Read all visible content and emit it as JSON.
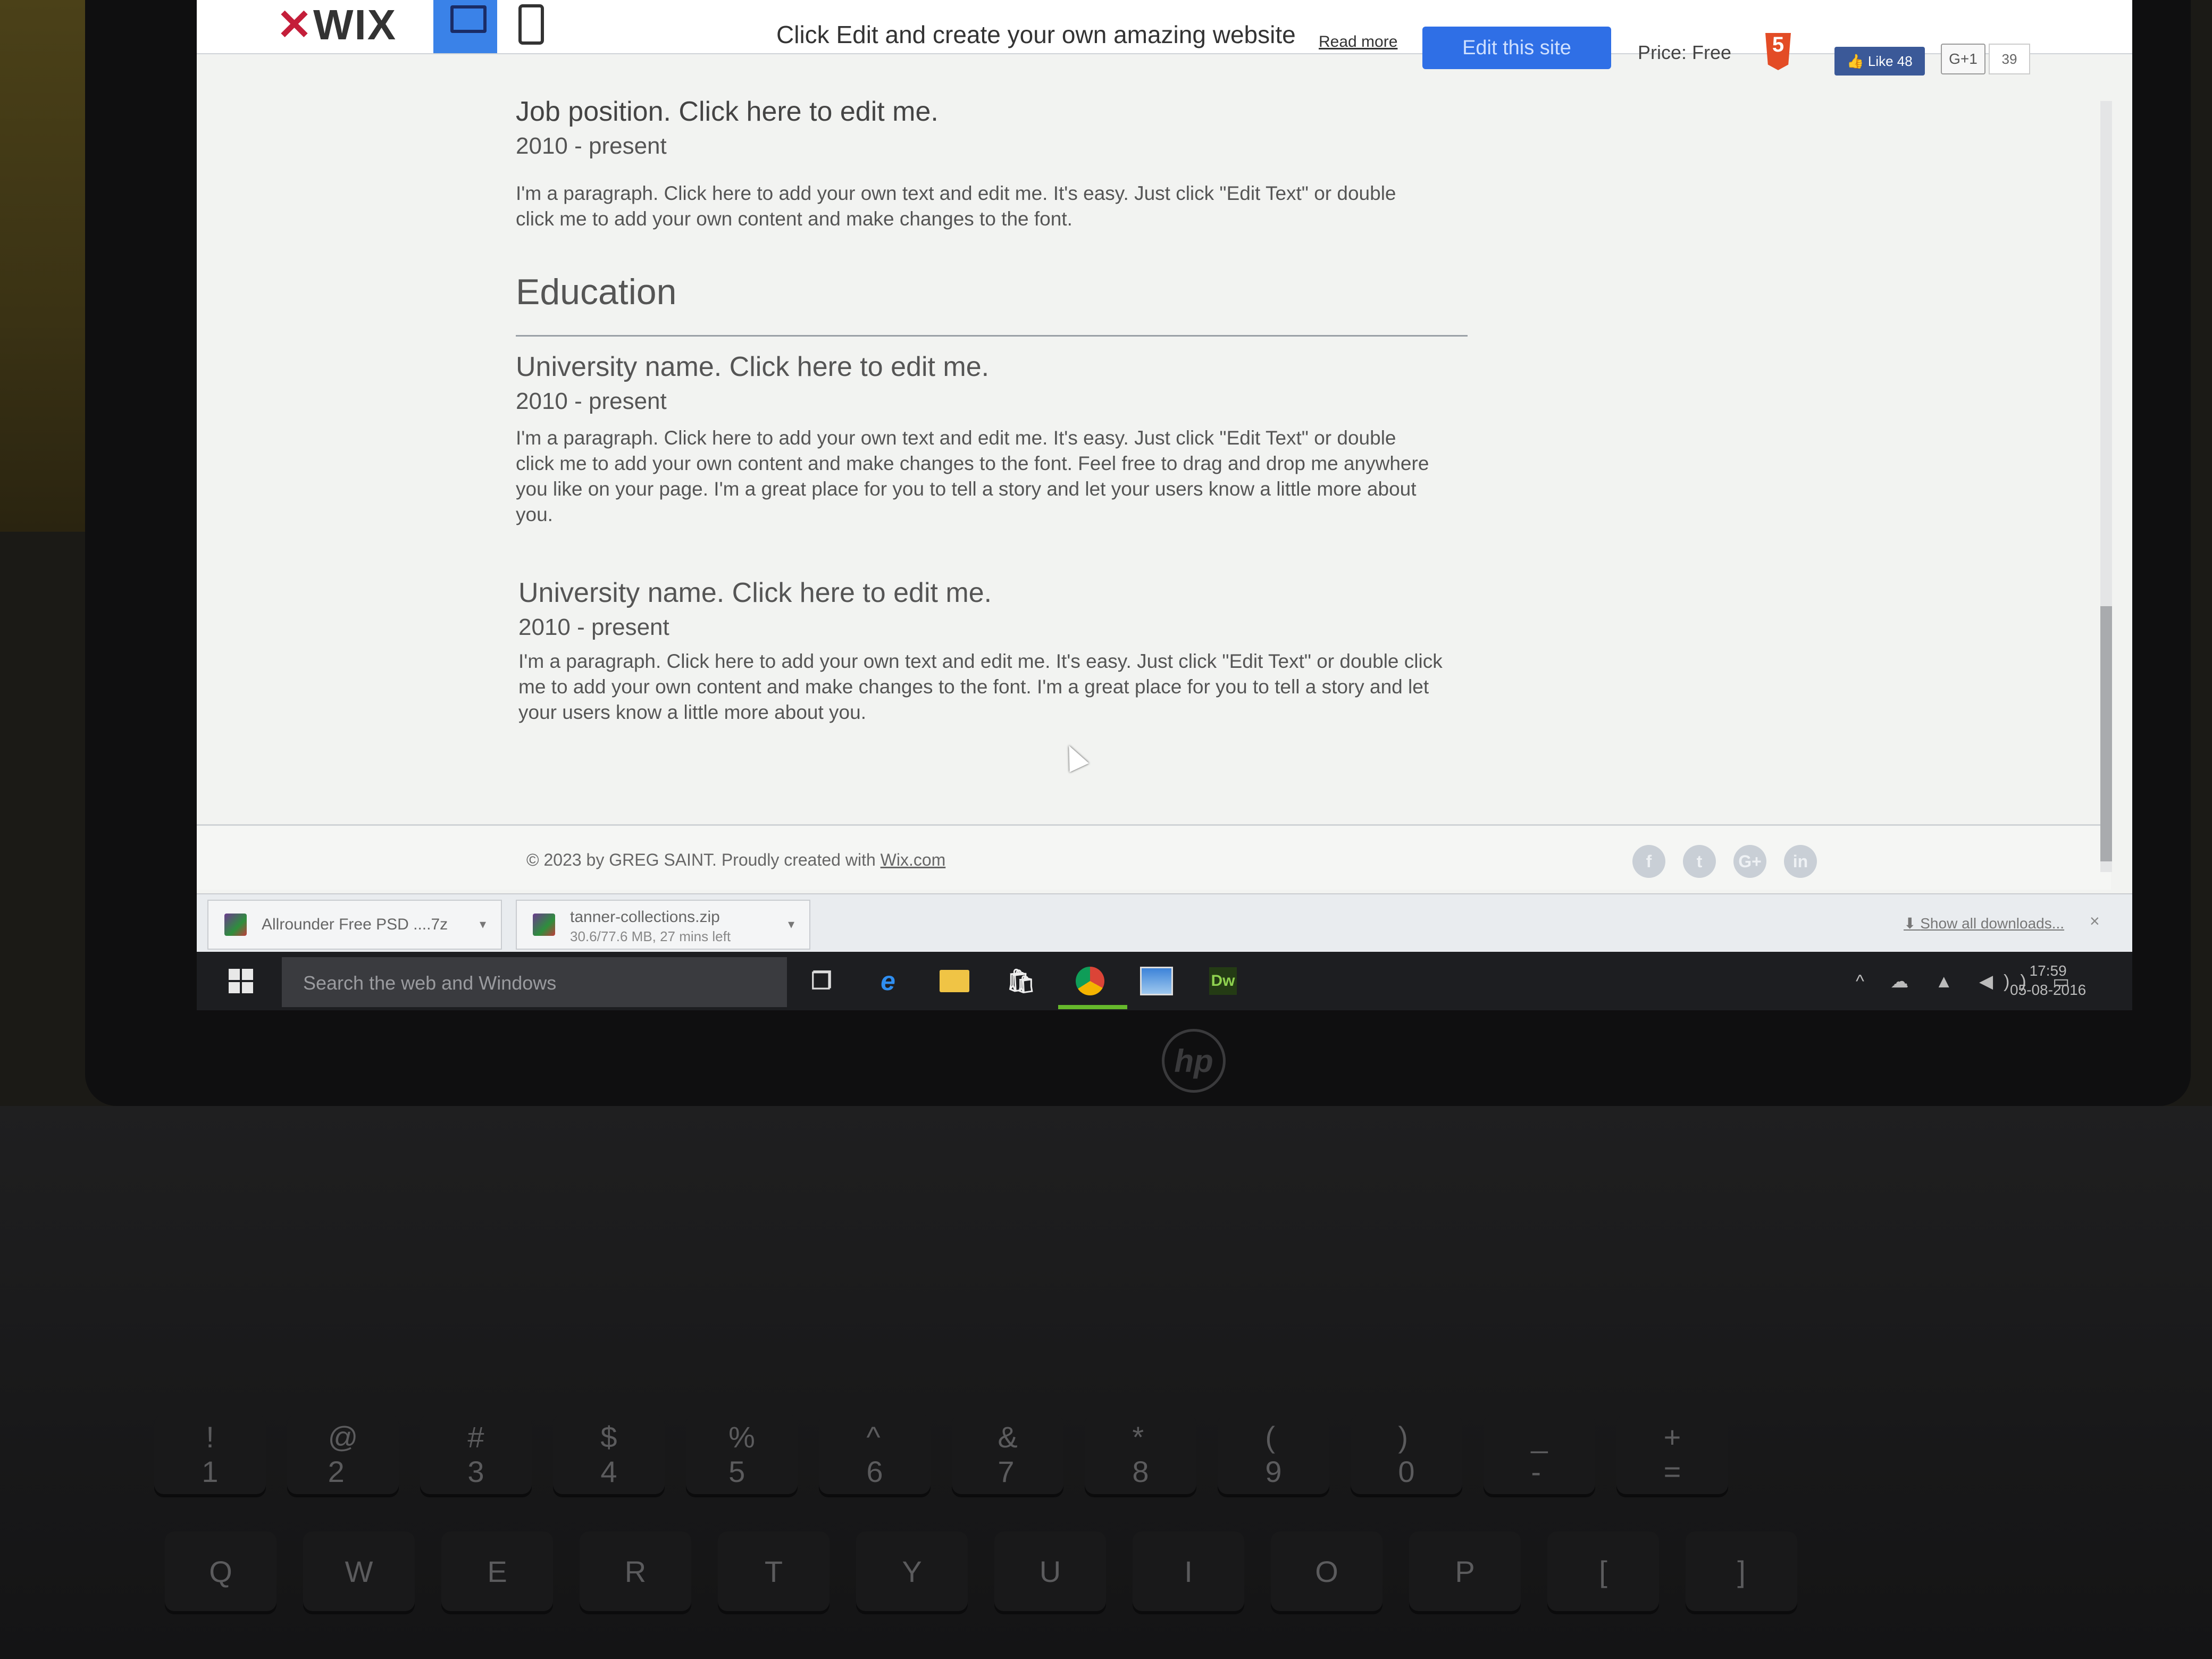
{
  "wixbar": {
    "logo": "WIX",
    "promo_text": "Click Edit and create your own amazing website",
    "read_more": "Read more",
    "edit_button": "Edit this site",
    "price": "Price: Free",
    "html5_icon": "html5-icon",
    "fb_like": "Like 48",
    "gplus_label": "G+1",
    "gplus_count": "39"
  },
  "resume": {
    "job": {
      "title": "Job position. Click here to edit me.",
      "date": "2010 - present",
      "paragraph": "I'm a paragraph. Click here to add your own text and edit me. It's easy. Just click \"Edit Text\" or double click me to add your own content and make changes to the font."
    },
    "education_title": "Education",
    "education": [
      {
        "title": "University name. Click here to edit me.",
        "date": "2010 - present",
        "paragraph": "I'm a paragraph. Click here to add your own text and edit me. It's easy. Just click \"Edit Text\" or double click me to add your own content and make changes to the font. Feel free to drag and drop me anywhere you like on your page. I'm a great place for you to tell a story and let your users know a little more about you."
      },
      {
        "title": "University name. Click here to edit me.",
        "date": "2010 - present",
        "paragraph": "I'm a paragraph. Click here to add your own text and edit me. It's easy. Just click \"Edit Text\" or double click me to add your own content and make changes to the font. I'm a great place for you to tell a story and let your users know a little more about you."
      }
    ]
  },
  "footer": {
    "copyright": "© 2023 by GREG SAINT. Proudly created with ",
    "link": "Wix.com",
    "social": [
      "f",
      "t",
      "G+",
      "in"
    ]
  },
  "downloads": {
    "items": [
      {
        "name": "Allrounder Free PSD ....7z",
        "sub": ""
      },
      {
        "name": "tanner-collections.zip",
        "sub": "30.6/77.6 MB, 27 mins left"
      }
    ],
    "show_all": "Show all downloads...",
    "close": "×"
  },
  "taskbar": {
    "search_placeholder": "Search the web and Windows",
    "apps": [
      "task-view-icon",
      "edge-icon",
      "file-explorer-icon",
      "store-icon",
      "chrome-icon",
      "photos-icon",
      "dreamweaver-icon"
    ],
    "dw_label": "Dw",
    "clock_time": "17:59",
    "clock_date": "05-08-2016"
  },
  "keyboard": {
    "hp_logo": "hp",
    "number_row": [
      "!\n1",
      "@\n2",
      "#\n3",
      "$\n4",
      "%\n5",
      "^\n6",
      "&\n7",
      "*\n8",
      "(\n9",
      ")\n0",
      "_\n-",
      "+\n="
    ],
    "letter_row": [
      "Q",
      "W",
      "E",
      "R",
      "T",
      "Y",
      "U",
      "I",
      "O",
      "P",
      "[",
      "]"
    ]
  }
}
